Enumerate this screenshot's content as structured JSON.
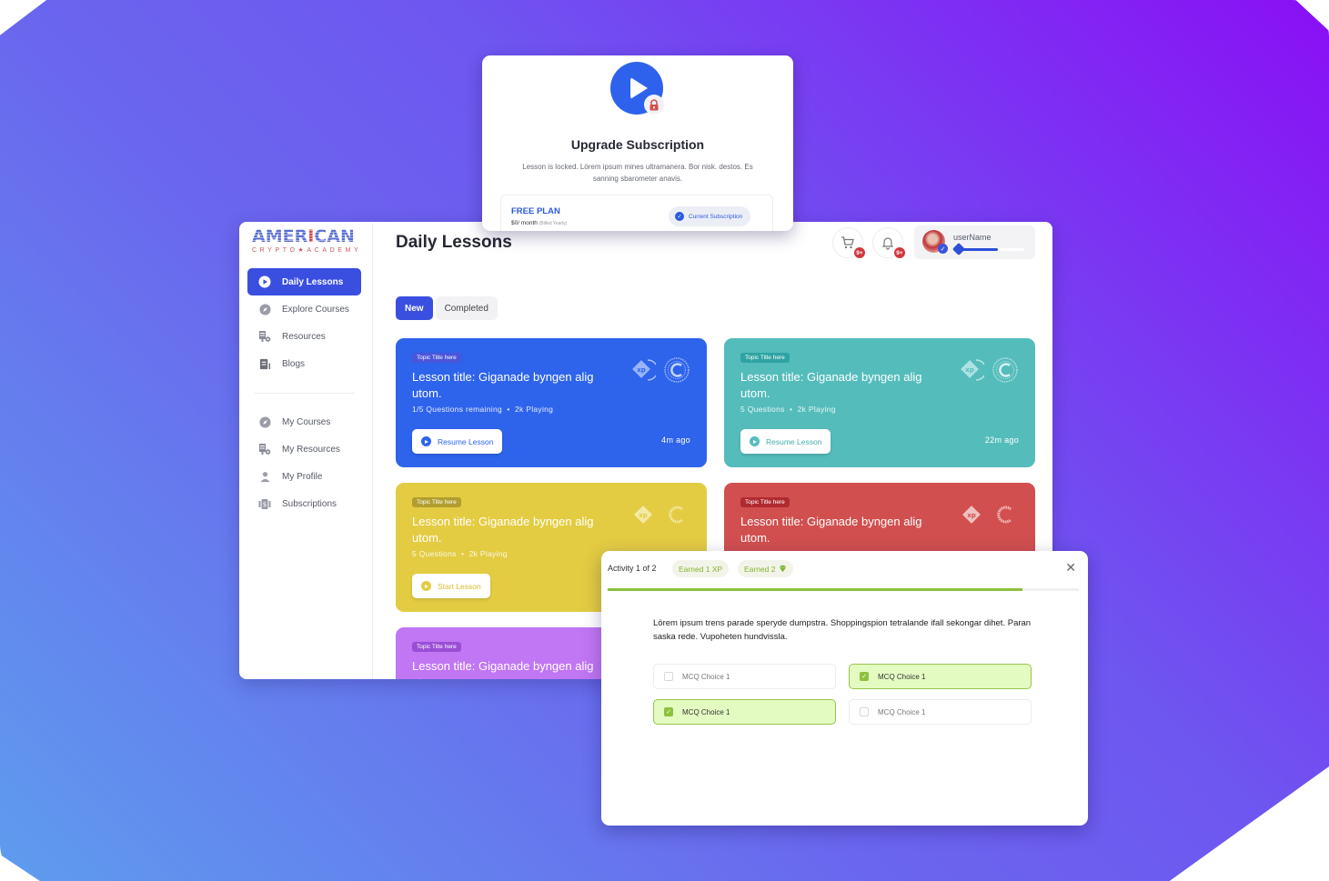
{
  "colors": {
    "primary": "#3a4fe0",
    "card_blue": "#2e63ec",
    "card_teal": "#55bcbc",
    "card_yellow": "#e3cc42",
    "card_red": "#d14f4f",
    "card_purple": "#c176f4",
    "success_green": "#8cc13e",
    "badge_red": "#d2373f"
  },
  "logo": {
    "main_a": "AMER",
    "main_i": "I",
    "main_b": "CAN",
    "sub": "CRYPTO★ACADEMY"
  },
  "sidebar": {
    "primary": [
      {
        "label": "Daily Lessons",
        "icon": "play-circle-icon",
        "active": true
      },
      {
        "label": "Explore Courses",
        "icon": "compass-icon"
      },
      {
        "label": "Resources",
        "icon": "resources-icon"
      },
      {
        "label": "Blogs",
        "icon": "document-icon"
      }
    ],
    "secondary": [
      {
        "label": "My Courses",
        "icon": "compass-icon"
      },
      {
        "label": "My Resources",
        "icon": "resources-icon"
      },
      {
        "label": "My Profile",
        "icon": "user-icon"
      },
      {
        "label": "Subscriptions",
        "icon": "subscription-icon"
      }
    ]
  },
  "header": {
    "title": "Daily Lessons",
    "cart_badge": "9+",
    "notifications_badge": "9+",
    "user": {
      "name": "userName",
      "xp_progress": 0.6
    }
  },
  "tabs": [
    {
      "label": "New",
      "active": true
    },
    {
      "label": "Completed",
      "active": false
    }
  ],
  "lessons": [
    {
      "topic": "Topic Title here",
      "title": "Lesson title: Giganade byngen alig utom.",
      "questions": "1/5 Questions remaining",
      "playing": "2k Playing",
      "cta": "Resume Lesson",
      "time": "4m ago"
    },
    {
      "topic": "Topic Title here",
      "title": "Lesson title: Giganade byngen alig utom.",
      "questions": "5 Questions",
      "playing": "2k Playing",
      "cta": "Resume Lesson",
      "time": "22m ago"
    },
    {
      "topic": "Topic Title here",
      "title": "Lesson title: Giganade byngen alig utom.",
      "questions": "5 Questions",
      "playing": "2k Playing",
      "cta": "Start Lesson",
      "time": ""
    },
    {
      "topic": "Topic Title here",
      "title": "Lesson title: Giganade byngen alig utom.",
      "questions": "",
      "playing": "",
      "cta": "",
      "time": ""
    },
    {
      "topic": "Topic Title here",
      "title": "Lesson title: Giganade byngen alig utom.",
      "questions": "",
      "playing": "",
      "cta": "",
      "time": ""
    }
  ],
  "upgrade_modal": {
    "title": "Upgrade Subscription",
    "description": "Lesson is locked. Lörem ipsum mines ultramanera. Bor nisk. destos. Es sanning sbarometer anavis.",
    "plan_name": "FREE PLAN",
    "plan_price": "$0/ month",
    "plan_billing": "(Billed Yearly)",
    "badge": "Current Subscription"
  },
  "activity_modal": {
    "label": "Activity 1 of 2",
    "earned_xp": "Earned 1 XP",
    "earned_gems": "Earned 2",
    "progress": 0.88,
    "question": "Lörem ipsum trens parade speryde dumpstra. Shoppingspion tetralande ifall sekongar dihet. Paran saska rede. Vupoheten hundvissla.",
    "choices": [
      {
        "label": "MCQ Choice 1",
        "checked": false
      },
      {
        "label": "MCQ Choice 1",
        "checked": true
      },
      {
        "label": "MCQ Choice 1",
        "checked": true
      },
      {
        "label": "MCQ Choice 1",
        "checked": false
      }
    ]
  }
}
